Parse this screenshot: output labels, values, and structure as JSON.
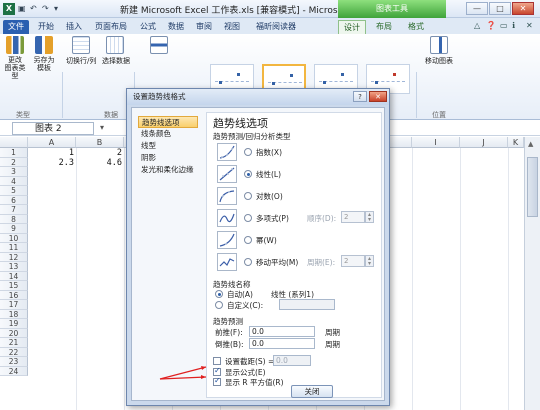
{
  "window": {
    "title": "新建 Microsoft Excel 工作表.xls [兼容模式] - Microsoft Excel",
    "context_tools": "图表工具",
    "minimize": "—",
    "maximize": "□",
    "close": "✕"
  },
  "tabs": [
    "文件",
    "开始",
    "插入",
    "页面布局",
    "公式",
    "数据",
    "审阅",
    "视图",
    "福昕阅读器",
    "设计",
    "布局",
    "格式"
  ],
  "ribbon": {
    "change_type": "更改\n图表类型",
    "save_template": "另存为\n模板",
    "switch_row_col": "切换行/列",
    "select_data": "选择数据",
    "move_chart": "移动图表",
    "group_type": "类型",
    "group_data": "数据",
    "group_location": "位置"
  },
  "formula": {
    "name_box": "图表 2"
  },
  "columns": [
    "A",
    "B",
    "C",
    "D",
    "E",
    "F",
    "G",
    "H",
    "I",
    "J",
    "K"
  ],
  "rows": [
    "1",
    "2",
    "3",
    "4",
    "5",
    "6",
    "7",
    "8",
    "9",
    "10",
    "11",
    "12",
    "13",
    "14",
    "15",
    "16",
    "17",
    "18",
    "19",
    "20",
    "21",
    "22",
    "23",
    "24"
  ],
  "cells": {
    "a1": "1",
    "b1": "2",
    "a2": "2.3",
    "b2": "4.6"
  },
  "dialog": {
    "title": "设置趋势线格式",
    "nav": [
      "趋势线选项",
      "线条颜色",
      "线型",
      "阴影",
      "发光和柔化边缘"
    ],
    "panel_title": "趋势线选项",
    "section_type": "趋势预测/回归分析类型",
    "types": [
      "指数(X)",
      "线性(L)",
      "对数(O)",
      "多项式(P)",
      "幂(W)",
      "移动平均(M)"
    ],
    "selected_type": "线性(L)",
    "order_label": "顺序(D):",
    "order_value": "2",
    "period_label": "周期(E):",
    "period_value": "2",
    "section_name": "趋势线名称",
    "auto_label": "自动(A)",
    "auto_value": "线性 (系列1)",
    "custom_label": "自定义(C):",
    "section_forecast": "趋势预测",
    "forward_label": "前推(F):",
    "forward_value": "0.0",
    "backward_label": "倒推(B):",
    "backward_value": "0.0",
    "period_unit": "周期",
    "intercept_label": "设置截距(S) =",
    "intercept_value": "0.0",
    "show_equation": "显示公式(E)",
    "show_r2": "显示 R 平方值(R)",
    "close_button": "关闭"
  },
  "colors": {
    "file_tab": "#2a5fb0",
    "context_tools": "#3fa33a",
    "annotation_arrow": "#e02020"
  }
}
